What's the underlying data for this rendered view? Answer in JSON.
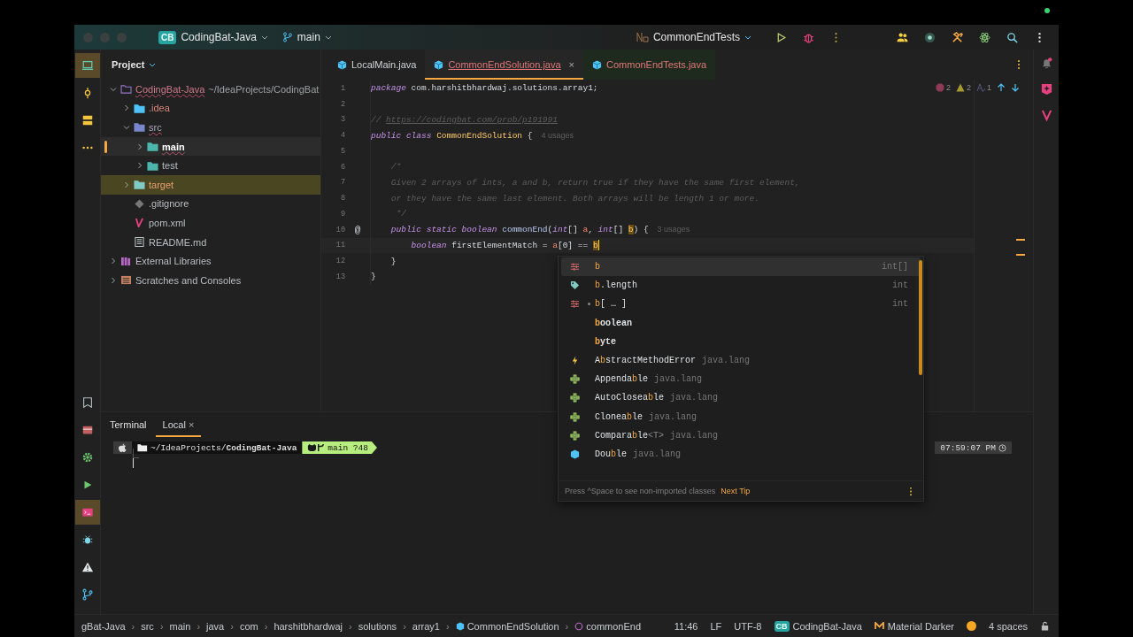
{
  "title_bar": {
    "project_badge": "CB",
    "project": "CodingBat-Java",
    "branch": "main",
    "run_config": "CommonEndTests"
  },
  "tool_strip": {
    "top": [
      {
        "kind": "project",
        "selected": true
      },
      {
        "kind": "commit",
        "selected": false
      },
      {
        "kind": "structure",
        "selected": false
      },
      {
        "kind": "more",
        "selected": false
      }
    ],
    "bottom": [
      {
        "kind": "bookmark",
        "selected": false
      },
      {
        "kind": "archive",
        "selected": false
      },
      {
        "kind": "services",
        "selected": false
      },
      {
        "kind": "run",
        "selected": false
      },
      {
        "kind": "terminal",
        "selected": true
      },
      {
        "kind": "bug",
        "selected": false
      },
      {
        "kind": "problems",
        "selected": false
      },
      {
        "kind": "git",
        "selected": false
      }
    ]
  },
  "project_panel": {
    "title": "Project",
    "tree": [
      {
        "label": "CodingBat-Java",
        "kind": "module",
        "path": "~/IdeaProjects/CodingBat",
        "expanded": true,
        "selected": false,
        "has_errors": true,
        "children": [
          {
            "label": ".idea",
            "kind": "folder_config",
            "expanded": false,
            "selected": false,
            "has_errors": false
          },
          {
            "label": "src",
            "kind": "folder_src",
            "expanded": true,
            "selected": false,
            "has_errors": true,
            "children": [
              {
                "label": "main",
                "kind": "folder_module",
                "expanded": false,
                "selected": true,
                "has_errors": true
              },
              {
                "label": "test",
                "kind": "folder_module",
                "expanded": false,
                "selected": false,
                "has_errors": false
              }
            ]
          },
          {
            "label": "target",
            "kind": "folder_excluded",
            "expanded": false,
            "selected": false,
            "has_errors": false
          },
          {
            "label": ".gitignore",
            "kind": "gitignore",
            "selected": false,
            "has_errors": false
          },
          {
            "label": "pom.xml",
            "kind": "maven",
            "selected": false,
            "has_errors": false
          },
          {
            "label": "README.md",
            "kind": "markdown",
            "selected": false,
            "has_errors": false
          }
        ]
      },
      {
        "label": "External Libraries",
        "kind": "libraries",
        "expanded": false,
        "selected": false,
        "has_errors": false
      },
      {
        "label": "Scratches and Consoles",
        "kind": "scratches",
        "expanded": false,
        "selected": false,
        "has_errors": false
      }
    ]
  },
  "editor": {
    "tabs": [
      {
        "label": "LocalMain.java",
        "kind": "class",
        "selected": false,
        "has_errors": false
      },
      {
        "label": "CommonEndSolution.java",
        "kind": "class",
        "selected": true,
        "has_errors": true,
        "close": "×"
      },
      {
        "label": "CommonEndTests.java",
        "kind": "test",
        "selected": false,
        "has_errors": true
      }
    ],
    "inspections": {
      "errors": "2",
      "warnings": "2",
      "typos": "1"
    },
    "lines": [
      {
        "number": "1",
        "current": false,
        "tokens": [
          {
            "text": "package",
            "kind": "kw"
          },
          {
            "text": " com.harshitbhardwaj.solutions.array1",
            "kind": "plain"
          },
          {
            "text": ";",
            "kind": "punct"
          }
        ]
      },
      {
        "number": "2",
        "current": false
      },
      {
        "number": "3",
        "current": false,
        "tokens": [
          {
            "text": "// ",
            "kind": "comment"
          },
          {
            "text": "https://codingbat.com/prob/p191991",
            "kind": "link"
          }
        ]
      },
      {
        "number": "4",
        "current": false,
        "tokens": [
          {
            "text": "public class ",
            "kind": "kw"
          },
          {
            "text": "CommonEndSolution",
            "kind": "cls"
          },
          {
            "text": " {",
            "kind": "punct"
          },
          {
            "text": "4 usages",
            "kind": "hint"
          }
        ]
      },
      {
        "number": "5",
        "current": false
      },
      {
        "number": "6",
        "current": false,
        "tokens": [
          {
            "text": "    /*",
            "kind": "comment"
          }
        ]
      },
      {
        "number": "7",
        "current": false,
        "tokens": [
          {
            "text": "    Given 2 arrays of ints, a and b, return true if they have the same first element,",
            "kind": "comment"
          }
        ]
      },
      {
        "number": "8",
        "current": false,
        "tokens": [
          {
            "text": "    or they have the same last element. Both arrays will be length 1 or more.",
            "kind": "comment"
          }
        ]
      },
      {
        "number": "9",
        "current": false,
        "tokens": [
          {
            "text": "     */",
            "kind": "comment"
          }
        ]
      },
      {
        "number": "10",
        "current": false,
        "gutter": "@",
        "tokens": [
          {
            "text": "    public static boolean ",
            "kind": "kw"
          },
          {
            "text": "commonEnd",
            "kind": "method"
          },
          {
            "text": "(",
            "kind": "punct"
          },
          {
            "text": "int",
            "kind": "kw"
          },
          {
            "text": "[] ",
            "kind": "punct"
          },
          {
            "text": "a",
            "kind": "param"
          },
          {
            "text": ", ",
            "kind": "punct"
          },
          {
            "text": "int",
            "kind": "kw"
          },
          {
            "text": "[] ",
            "kind": "punct"
          },
          {
            "text": "b",
            "kind": "param_hl"
          },
          {
            "text": ") {",
            "kind": "punct"
          },
          {
            "text": "3 usages",
            "kind": "hint"
          }
        ]
      },
      {
        "number": "11",
        "current": true,
        "tokens": [
          {
            "text": "        boolean",
            "kind": "kw"
          },
          {
            "text": " firstElementMatch = ",
            "kind": "plain"
          },
          {
            "text": "a",
            "kind": "param"
          },
          {
            "text": "[0] == ",
            "kind": "punct"
          },
          {
            "text": "b",
            "kind": "param_hl"
          }
        ]
      },
      {
        "number": "12",
        "current": false,
        "tokens": [
          {
            "text": "    }",
            "kind": "punct"
          }
        ]
      },
      {
        "number": "13",
        "current": false,
        "tokens": [
          {
            "text": "}",
            "kind": "punct"
          }
        ]
      }
    ]
  },
  "completion": {
    "items": [
      {
        "kind": "variable",
        "selected": true,
        "parts": [
          {
            "text": "b",
            "match": true
          }
        ],
        "type": "int[]"
      },
      {
        "kind": "field",
        "selected": false,
        "parts": [
          {
            "text": "b",
            "match": true
          },
          {
            "text": ".length",
            "match": false
          }
        ],
        "type": "int"
      },
      {
        "kind": "variable_indexed",
        "selected": false,
        "parts": [
          {
            "text": "b",
            "match": true
          },
          {
            "text": "[ … ]",
            "match": false
          }
        ],
        "type": "int"
      },
      {
        "kind": "keyword",
        "selected": false,
        "parts": [
          {
            "text": "b",
            "match": true
          },
          {
            "text": "oolean",
            "match": false
          }
        ]
      },
      {
        "kind": "keyword",
        "selected": false,
        "parts": [
          {
            "text": "b",
            "match": true
          },
          {
            "text": "yte",
            "match": false
          }
        ]
      },
      {
        "kind": "exception",
        "selected": false,
        "parts": [
          {
            "text": "A",
            "match": false
          },
          {
            "text": "b",
            "match": true
          },
          {
            "text": "stractMethodError",
            "match": false
          }
        ],
        "package": "java.lang"
      },
      {
        "kind": "interface",
        "selected": false,
        "parts": [
          {
            "text": "Appenda",
            "match": false
          },
          {
            "text": "b",
            "match": true
          },
          {
            "text": "le",
            "match": false
          }
        ],
        "package": "java.lang"
      },
      {
        "kind": "interface",
        "selected": false,
        "parts": [
          {
            "text": "AutoClosea",
            "match": false
          },
          {
            "text": "b",
            "match": true
          },
          {
            "text": "le",
            "match": false
          }
        ],
        "package": "java.lang"
      },
      {
        "kind": "interface",
        "selected": false,
        "parts": [
          {
            "text": "Clonea",
            "match": false
          },
          {
            "text": "b",
            "match": true
          },
          {
            "text": "le",
            "match": false
          }
        ],
        "package": "java.lang"
      },
      {
        "kind": "interface",
        "selected": false,
        "parts": [
          {
            "text": "Compara",
            "match": false
          },
          {
            "text": "b",
            "match": true
          },
          {
            "text": "le",
            "match": false
          }
        ],
        "generic": "<T>",
        "package": "java.lang"
      },
      {
        "kind": "class",
        "selected": false,
        "parts": [
          {
            "text": "Dou",
            "match": false
          },
          {
            "text": "b",
            "match": true
          },
          {
            "text": "le",
            "match": false
          }
        ],
        "package": "java.lang"
      }
    ],
    "footer": "Press ^Space to see non-imported classes",
    "tip_link": "Next Tip"
  },
  "terminal": {
    "title": "Terminal",
    "tabs": [
      {
        "label": "Local",
        "selected": true,
        "close": "×"
      }
    ],
    "prompt": {
      "path": "~/IdeaProjects/**CodingBat-Java**",
      "branch": "main ?48",
      "time": "07:59:07 PM"
    }
  },
  "status_bar": {
    "separator": "›",
    "breadcrumbs": [
      {
        "label": "gBat-Java",
        "kind": "text"
      },
      {
        "label": "src",
        "kind": "text"
      },
      {
        "label": "main",
        "kind": "text"
      },
      {
        "label": "java",
        "kind": "text"
      },
      {
        "label": "com",
        "kind": "text"
      },
      {
        "label": "harshitbhardwaj",
        "kind": "text"
      },
      {
        "label": "solutions",
        "kind": "text"
      },
      {
        "label": "array1",
        "kind": "text"
      },
      {
        "label": "CommonEndSolution",
        "kind": "class"
      },
      {
        "label": "commonEnd",
        "kind": "method"
      }
    ],
    "position": "11:46",
    "line_separator": "LF",
    "encoding": "UTF-8",
    "project_badge": "CB",
    "project": "CodingBat-Java",
    "theme": "Material Darker",
    "indent": "4 spaces"
  }
}
